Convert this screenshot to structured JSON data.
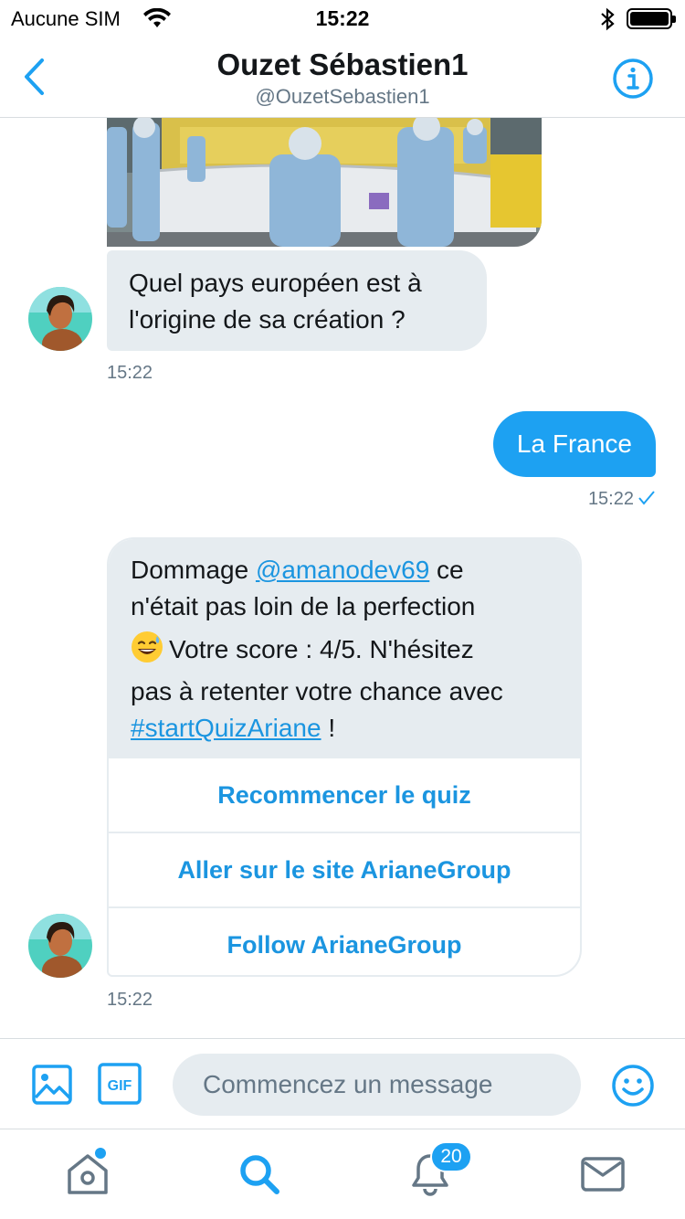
{
  "status_bar": {
    "carrier": "Aucune SIM",
    "time": "15:22",
    "icons": [
      "wifi-icon",
      "bluetooth-icon",
      "battery-icon"
    ]
  },
  "header": {
    "name": "Ouzet Sébastien1",
    "handle": "@OuzetSebastien1",
    "icons": [
      "back-chevron-icon",
      "info-icon"
    ]
  },
  "messages": {
    "question": {
      "lines": [
        "Quel pays européen est à",
        "l'origine de sa création ?"
      ],
      "time": "15:22"
    },
    "answer": {
      "text": "La France",
      "time": "15:22"
    },
    "result": {
      "line1_before": "Dommage ",
      "mention": "@amanodev69",
      "line1_after": " ce",
      "line2": "n'était pas loin de la perfection",
      "emoji": "😅",
      "line3": "Votre score : 4/5. N'hésitez",
      "line4": "pas à retenter votre chance avec",
      "hashtag": "#startQuizAriane",
      "line5_after": " !",
      "buttons": [
        "Recommencer le quiz",
        "Aller sur le site ArianeGroup",
        "Follow ArianeGroup"
      ],
      "time": "15:22"
    }
  },
  "composer": {
    "placeholder": "Commencez un message",
    "gif_label": "GIF"
  },
  "tabbar": {
    "tabs": [
      "home-icon",
      "search-icon",
      "notifications-icon",
      "messages-icon"
    ],
    "active": "search",
    "notif_count": "20"
  },
  "colors": {
    "accent": "#1da1f2",
    "link": "#1b95e0",
    "bubble_gray": "#e6ecf0",
    "secondary_text": "#657786"
  }
}
